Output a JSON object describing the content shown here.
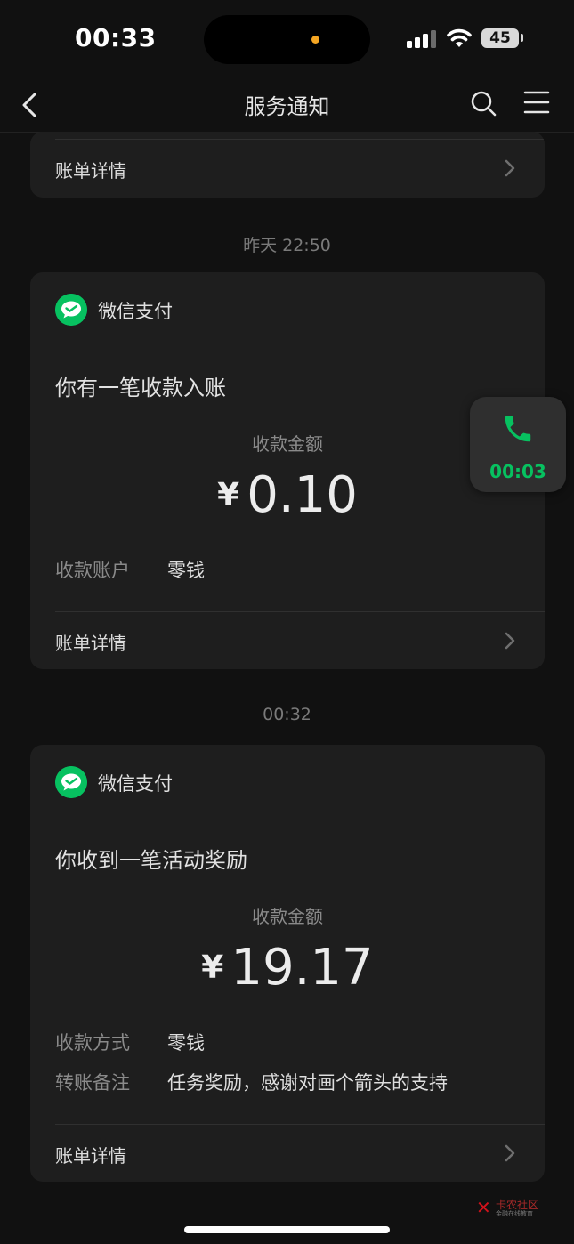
{
  "status_bar": {
    "time": "00:33",
    "battery": "45"
  },
  "navbar": {
    "title": "服务通知"
  },
  "timestamps": {
    "second": "昨天 22:50",
    "third": "00:32"
  },
  "cards": [
    {
      "detail_label": "账单详情"
    },
    {
      "brand": "微信支付",
      "headline": "你有一笔收款入账",
      "amount_label": "收款金额",
      "currency": "¥",
      "amount": "0.10",
      "fields": [
        {
          "key": "收款账户",
          "value": "零钱"
        }
      ],
      "detail_label": "账单详情"
    },
    {
      "brand": "微信支付",
      "headline": "你收到一笔活动奖励",
      "amount_label": "收款金额",
      "currency": "¥",
      "amount": "19.17",
      "fields": [
        {
          "key": "收款方式",
          "value": "零钱"
        },
        {
          "key": "转账备注",
          "value": "任务奖励，感谢对画个箭头的支持"
        }
      ],
      "detail_label": "账单详情"
    }
  ],
  "call_bubble": {
    "duration": "00:03"
  },
  "watermark": {
    "title": "卡农社区",
    "subtitle": "金融在线教育"
  },
  "colors": {
    "wechat_green": "#07c160",
    "background": "#111111",
    "card": "#1e1e1e"
  }
}
